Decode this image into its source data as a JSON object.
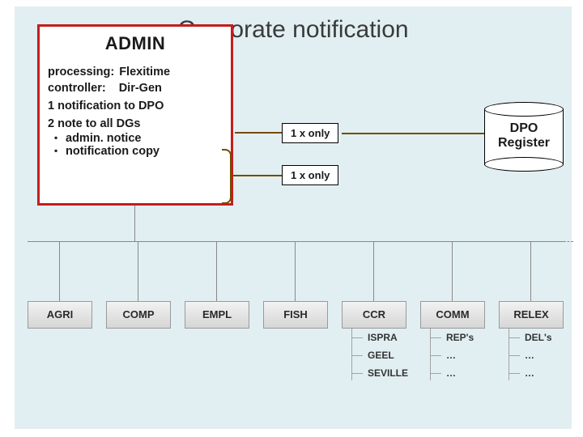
{
  "title": "Corporate notification",
  "admin": {
    "heading": "ADMIN",
    "processing_key": "processing:",
    "processing_val": "Flexitime",
    "controller_key": "controller:",
    "controller_val": "Dir-Gen",
    "item1": "1 notification to DPO",
    "item2": "2 note to all DGs",
    "item2_sub1": "admin. notice",
    "item2_sub2": "notification copy"
  },
  "tags": {
    "top": "1 x only",
    "bottom": "1 x only"
  },
  "register": {
    "line1": "DPO",
    "line2": "Register"
  },
  "org": {
    "nodes": [
      "AGRI",
      "COMP",
      "EMPL",
      "FISH",
      "CCR",
      "COMM",
      "RELEX"
    ],
    "children": {
      "CCR": [
        "ISPRA",
        "GEEL",
        "SEVILLE"
      ],
      "COMM": [
        "REP's",
        "…",
        "…"
      ],
      "RELEX": [
        "DEL's",
        "…",
        "…"
      ]
    }
  }
}
